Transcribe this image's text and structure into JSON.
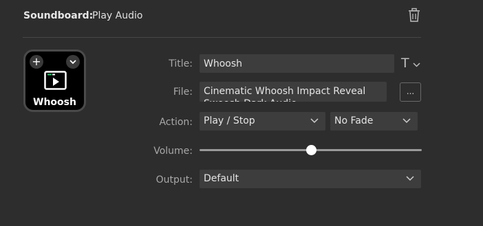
{
  "header": {
    "label": "Soundboard:",
    "action_name": "Play Audio",
    "delete_icon": "trash-icon"
  },
  "key": {
    "title": "Whoosh",
    "plus_label": "+",
    "menu_icon": "chevron-down-icon",
    "glyph_icon": "play-screen-icon"
  },
  "form": {
    "title_label": "Title:",
    "title_value": "Whoosh",
    "text_style_label": "T",
    "file_label": "File:",
    "file_value": "Cinematic Whoosh Impact Reveal Swoosh Dark Audio",
    "browse_label": "...",
    "action_label": "Action:",
    "action_value": "Play / Stop",
    "fade_value": "No Fade",
    "volume_label": "Volume:",
    "volume_level": 0.5,
    "output_label": "Output:",
    "output_value": "Default"
  },
  "colors": {
    "background": "#2d2d2d",
    "field": "#3d3d3d",
    "key_background": "#000000"
  }
}
